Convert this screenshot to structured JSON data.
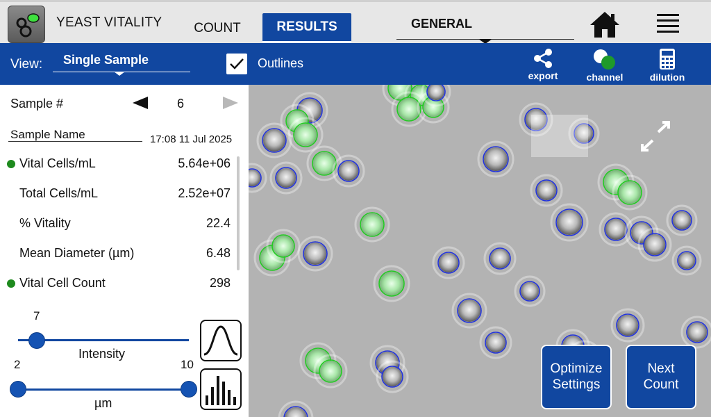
{
  "app": {
    "title": "YEAST VITALITY",
    "icon": "yeast-app-icon"
  },
  "tabs": [
    {
      "label": "COUNT",
      "active": false
    },
    {
      "label": "RESULTS",
      "active": true
    }
  ],
  "profile": {
    "selected": "GENERAL"
  },
  "nav": {
    "home_icon": "home-icon",
    "menu_icon": "hamburger-menu-icon"
  },
  "toolbar": {
    "view_label": "View:",
    "view_selected": "Single Sample",
    "outlines_label": "Outlines",
    "outlines_checked": true,
    "buttons": [
      {
        "label": "export",
        "icon": "share-icon"
      },
      {
        "label": "channel",
        "icon": "channel-icon"
      },
      {
        "label": "dilution",
        "icon": "calculator-icon"
      }
    ]
  },
  "panel": {
    "sample_label": "Sample #",
    "sample_number": "6",
    "sample_name_label": "Sample Name",
    "timestamp": "17:08 11 Jul 2025",
    "metrics": [
      {
        "label": "Vital Cells/mL",
        "value": "5.64e+06",
        "dot": true
      },
      {
        "label": "Total Cells/mL",
        "value": "2.52e+07",
        "dot": false
      },
      {
        "label": "% Vitality",
        "value": "22.4",
        "dot": false
      },
      {
        "label": "Mean Diameter (µm)",
        "value": "6.48",
        "dot": false
      },
      {
        "label": "Vital Cell Count",
        "value": "298",
        "dot": true
      }
    ],
    "intensity_slider": {
      "value": "7",
      "caption": "Intensity"
    },
    "size_slider": {
      "min": "2",
      "max": "10",
      "caption": "µm"
    }
  },
  "image": {
    "outline_colors": {
      "vital": "#22cc22",
      "nonvital": "#2233dd"
    },
    "buttons": {
      "optimize": "Optimize\nSettings",
      "next": "Next\nCount"
    }
  },
  "colors": {
    "brand_blue": "#1147a0",
    "vital_green": "#1e8a1e",
    "topbar_gray": "#e7e7e7"
  }
}
